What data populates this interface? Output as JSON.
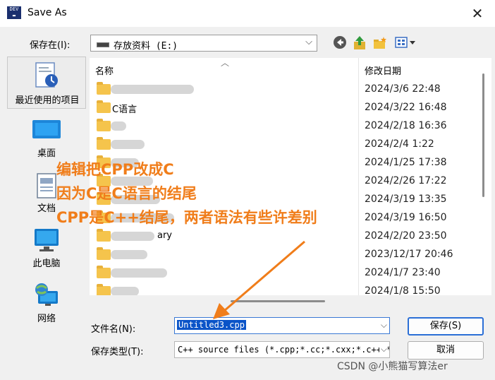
{
  "window": {
    "title": "Save As",
    "app_icon_text": "DEV",
    "close_glyph": "✕"
  },
  "location": {
    "label": "保存在(I):",
    "value": "存放资料 (E:)"
  },
  "toolbar": {
    "back_icon": "back-arrow-icon",
    "up_icon": "up-folder-icon",
    "new_folder_icon": "new-folder-icon",
    "view_menu_icon": "view-menu-icon"
  },
  "places": [
    {
      "label": "最近使用的项目",
      "icon": "recent-items-icon"
    },
    {
      "label": "桌面",
      "icon": "desktop-icon"
    },
    {
      "label": "文档",
      "icon": "documents-icon"
    },
    {
      "label": "此电脑",
      "icon": "this-pc-icon"
    },
    {
      "label": "网络",
      "icon": "network-icon"
    }
  ],
  "file_list": {
    "columns": {
      "name": "名称",
      "date": "修改日期"
    },
    "rows": [
      {
        "name": "",
        "date": "2024/3/6 22:48"
      },
      {
        "name": "C语言",
        "date": "2024/3/22 16:48"
      },
      {
        "name": "",
        "date": "2024/2/18 16:36"
      },
      {
        "name": "",
        "date": "2024/2/4 1:22"
      },
      {
        "name": "",
        "date": "2024/1/25 17:38"
      },
      {
        "name": "",
        "date": "2024/2/26 17:22"
      },
      {
        "name": "",
        "date": "2024/3/19 13:35"
      },
      {
        "name": "",
        "date": "2024/3/19 16:50"
      },
      {
        "name": "ary",
        "date": "2024/2/20 23:50"
      },
      {
        "name": "",
        "date": "2023/12/17 20:46"
      },
      {
        "name": "",
        "date": "2024/1/7 23:40"
      },
      {
        "name": "",
        "date": "2024/1/8 15:50"
      }
    ]
  },
  "filename": {
    "label": "文件名(N):",
    "value": "Untitled3.cpp"
  },
  "filetype": {
    "label": "保存类型(T):",
    "value": "C++ source files (*.cpp;*.cc;*.cxx;*.c++;*.hpp)"
  },
  "buttons": {
    "save": "保存(S)",
    "cancel": "取消"
  },
  "annotation": {
    "lines": [
      "编辑把CPP改成C",
      "因为C是C语言的结尾",
      "CPP是C++结尾，两者语法有些许差别"
    ],
    "color": "#f07d1a"
  },
  "watermark": "CSDN @小熊猫写算法er"
}
